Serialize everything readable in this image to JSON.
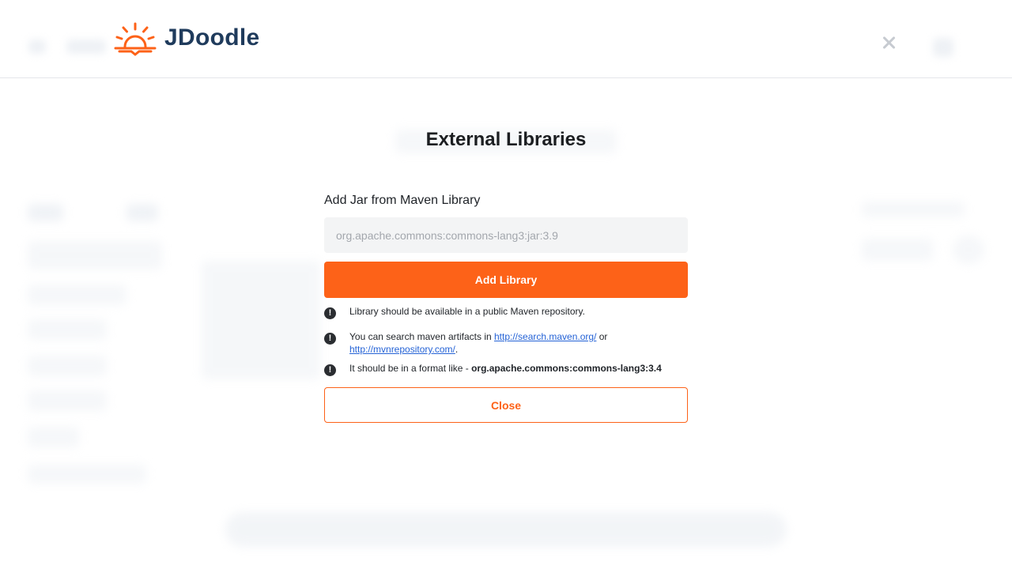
{
  "header": {
    "brand": "JDoodle",
    "accent_color": "#fd6218",
    "brand_color": "#1f3b5c"
  },
  "modal": {
    "title": "External Libraries",
    "field_label": "Add Jar from Maven Library",
    "input_value": "",
    "input_placeholder": "org.apache.commons:commons-lang3:jar:3.9",
    "add_button_label": "Add Library",
    "notes": {
      "n1": "Library should be available in a public Maven repository.",
      "n2_prefix": "You can search maven artifacts in ",
      "n2_link1": "http://search.maven.org/",
      "n2_middle": " or",
      "n2_link2": "http://mvnrepository.com/",
      "n2_suffix": ".",
      "n3_prefix": "It should be in a format like - ",
      "n3_bold": "org.apache.commons:commons-lang3:3.4"
    },
    "info_icon": "exclamation-circle-icon",
    "close_button_label": "Close"
  }
}
